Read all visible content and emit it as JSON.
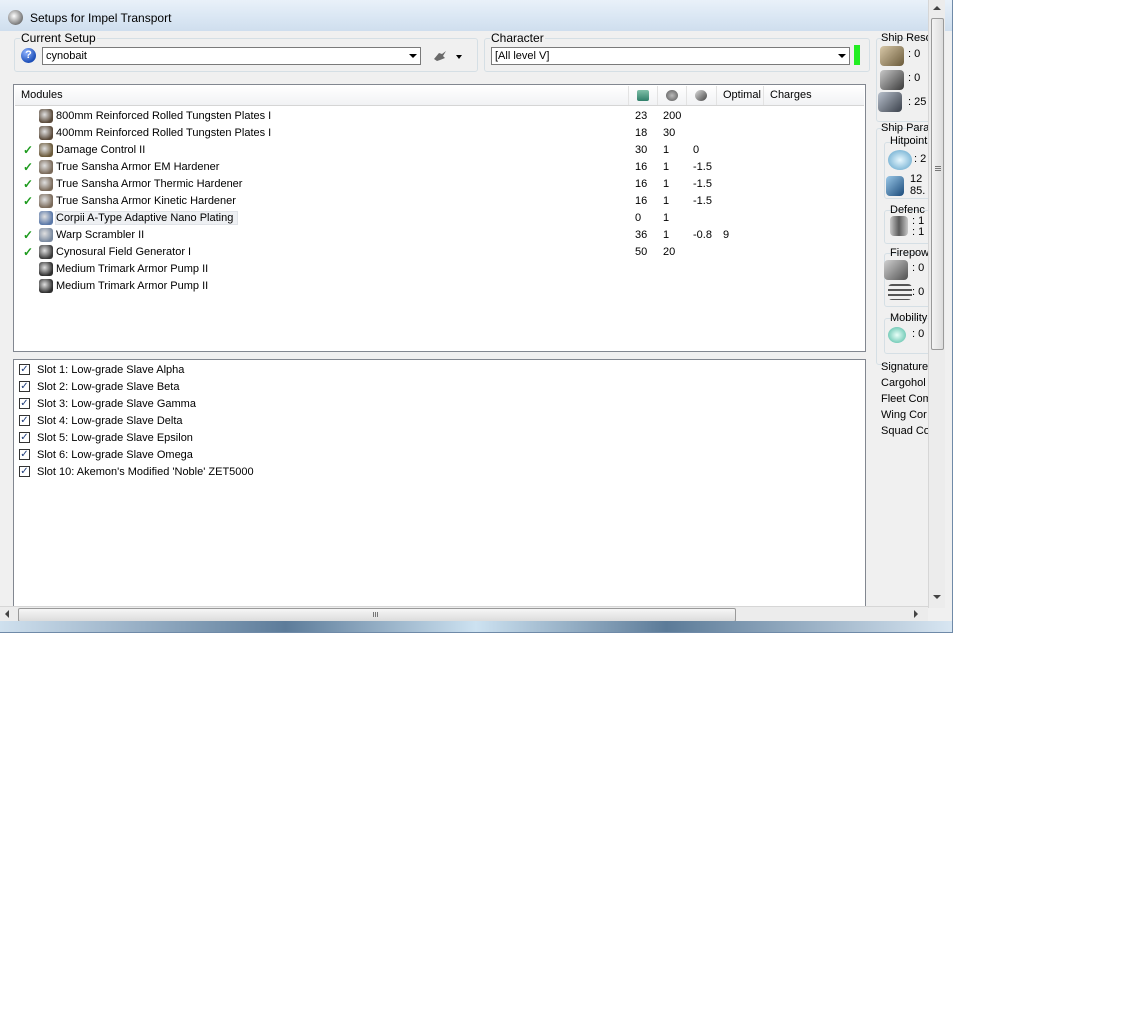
{
  "window": {
    "title": "Setups for Impel Transport"
  },
  "current_setup": {
    "label": "Current Setup",
    "value": "cynobait"
  },
  "character": {
    "label": "Character",
    "value": "[All level V]"
  },
  "modules": {
    "columns": [
      "Modules",
      "Optimal",
      "Charges"
    ],
    "rows": [
      {
        "checked": false,
        "name": "800mm Reinforced Rolled Tungsten Plates I",
        "cpu": "23",
        "pg": "200",
        "cap": "",
        "optimal": "",
        "icon_color": "#5a4a3a"
      },
      {
        "checked": false,
        "name": "400mm Reinforced Rolled Tungsten Plates I",
        "cpu": "18",
        "pg": "30",
        "cap": "",
        "optimal": "",
        "icon_color": "#5a4a3a"
      },
      {
        "checked": true,
        "name": "Damage Control II",
        "cpu": "30",
        "pg": "1",
        "cap": "0",
        "optimal": "",
        "icon_color": "#6b5a3a"
      },
      {
        "checked": true,
        "name": "True Sansha Armor EM Hardener",
        "cpu": "16",
        "pg": "1",
        "cap": "-1.5",
        "optimal": "",
        "icon_color": "#7a6a5a"
      },
      {
        "checked": true,
        "name": "True Sansha Armor Thermic Hardener",
        "cpu": "16",
        "pg": "1",
        "cap": "-1.5",
        "optimal": "",
        "icon_color": "#7a6a5a"
      },
      {
        "checked": true,
        "name": "True Sansha Armor Kinetic Hardener",
        "cpu": "16",
        "pg": "1",
        "cap": "-1.5",
        "optimal": "",
        "icon_color": "#7a6a5a"
      },
      {
        "checked": false,
        "name": "Corpii A-Type Adaptive Nano Plating",
        "cpu": "0",
        "pg": "1",
        "cap": "",
        "optimal": "",
        "icon_color": "#5a78a8"
      },
      {
        "checked": true,
        "name": "Warp Scrambler II",
        "cpu": "36",
        "pg": "1",
        "cap": "-0.8",
        "optimal": "9",
        "icon_color": "#7a8aa0"
      },
      {
        "checked": true,
        "name": "Cynosural Field Generator I",
        "cpu": "50",
        "pg": "20",
        "cap": "",
        "optimal": "",
        "icon_color": "#3a3a3a"
      },
      {
        "checked": false,
        "name": "Medium Trimark Armor Pump II",
        "cpu": "",
        "pg": "",
        "cap": "",
        "optimal": "",
        "icon_color": "#2f2f2f"
      },
      {
        "checked": false,
        "name": "Medium Trimark Armor Pump II",
        "cpu": "",
        "pg": "",
        "cap": "",
        "optimal": "",
        "icon_color": "#2f2f2f"
      }
    ]
  },
  "implants": [
    "Slot 1: Low-grade Slave Alpha",
    "Slot 2: Low-grade Slave Beta",
    "Slot 3: Low-grade Slave Gamma",
    "Slot 4: Low-grade Slave Delta",
    "Slot 5: Low-grade Slave Epsilon",
    "Slot 6: Low-grade Slave Omega",
    "Slot 10: Akemon's Modified 'Noble' ZET5000"
  ],
  "side": {
    "ship_resources": "Ship Reso",
    "res_values": [
      ": 0",
      ": 0",
      ": 25"
    ],
    "ship_params": "Ship Para",
    "hitpoints": "Hitpoint",
    "hp_values": [
      ": 2",
      "12",
      "85."
    ],
    "defence": "Defenc",
    "def_values": [
      ": 1",
      ": 1"
    ],
    "firepower": "Firepow",
    "fire_values": [
      ": 0",
      ": 0"
    ],
    "mobility": "Mobility",
    "mob_value": ": 0",
    "misc": [
      "Signature",
      "Cargohol",
      "Fleet Com",
      "Wing Cor",
      "Squad Co"
    ]
  },
  "colors": {
    "check_green": "#1e9b1e",
    "status_green": "#22ee22"
  }
}
